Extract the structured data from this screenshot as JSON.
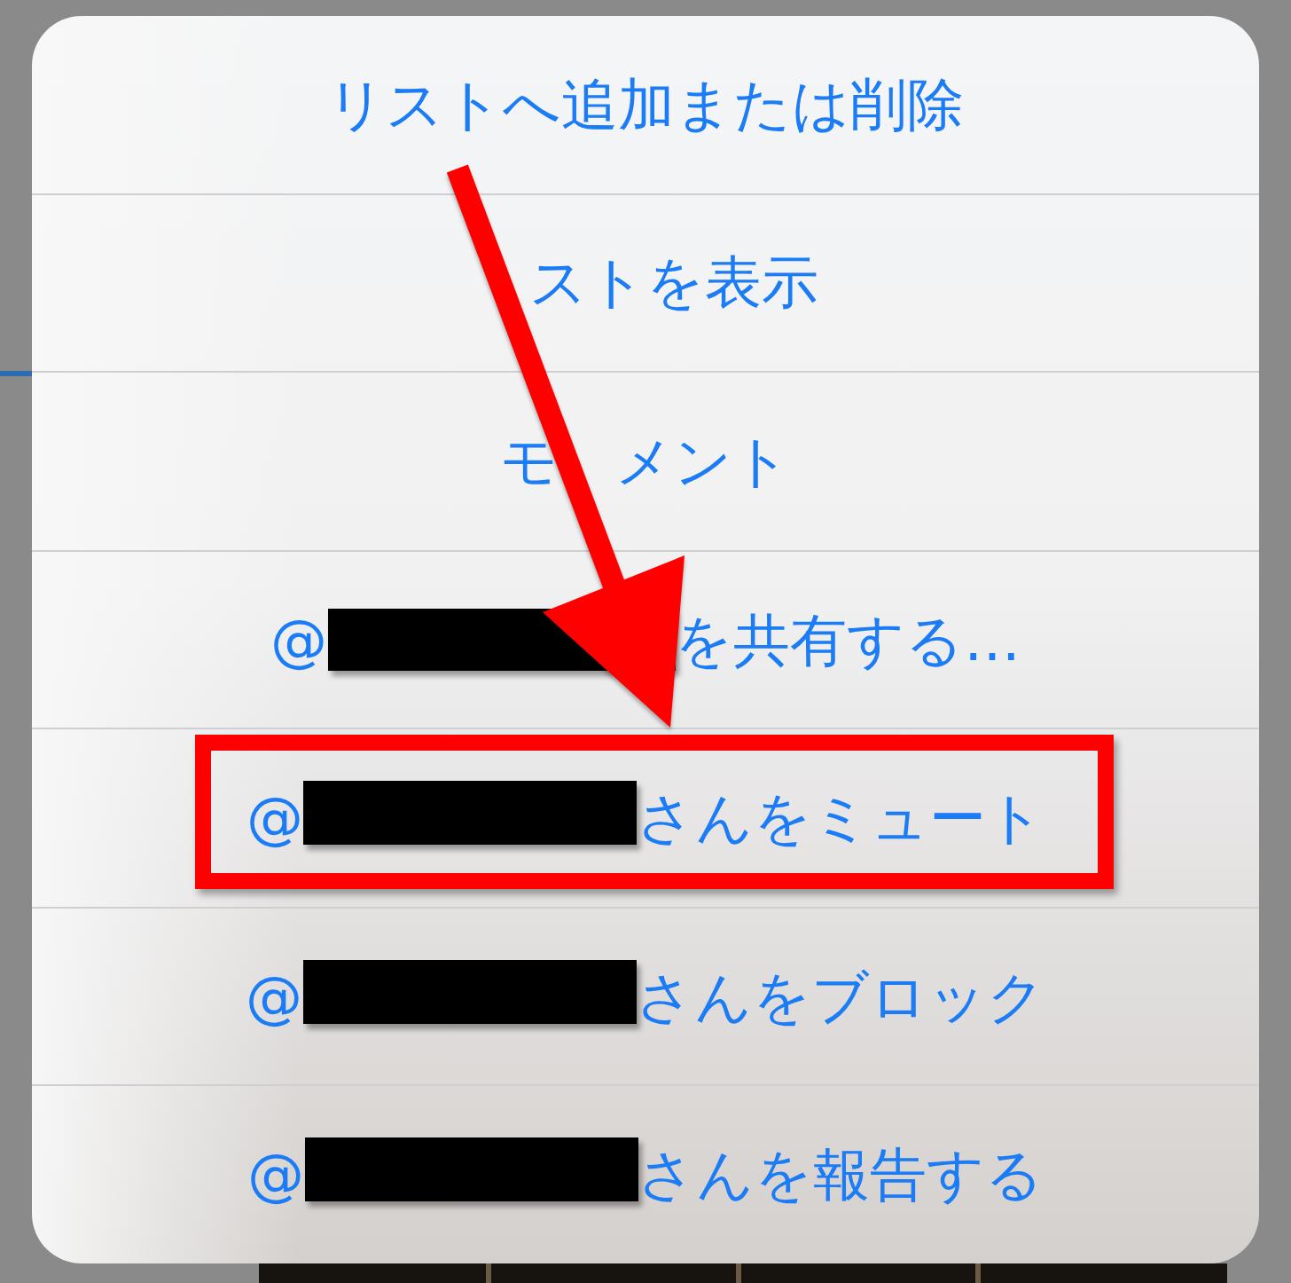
{
  "action_sheet": {
    "items": [
      {
        "label": "リストへ追加または削除",
        "redacted": false,
        "highlighted": false
      },
      {
        "label": "ストを表示",
        "redacted": false,
        "highlighted": false
      },
      {
        "label": "モ　メント",
        "redacted": false,
        "highlighted": false
      },
      {
        "prefix": "@",
        "redacted": true,
        "label": "を共有する…",
        "highlighted": false
      },
      {
        "prefix": "@",
        "redacted": true,
        "label": "さんをミュート",
        "highlighted": true
      },
      {
        "prefix": "@",
        "redacted": true,
        "label": "さんをブロック",
        "highlighted": false
      },
      {
        "prefix": "@",
        "redacted": true,
        "label": "さんを報告する",
        "highlighted": false
      }
    ]
  },
  "annotations": [
    {
      "kind": "arrow"
    }
  ]
}
